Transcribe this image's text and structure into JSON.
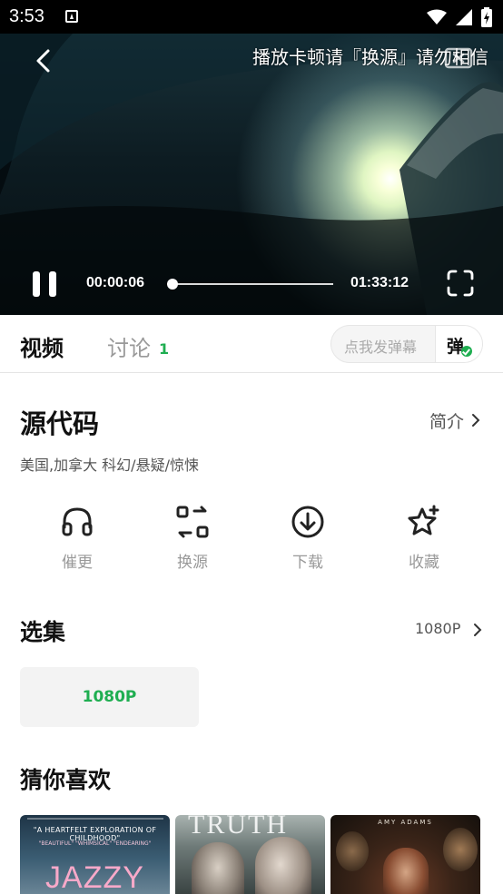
{
  "status_bar": {
    "time": "3:53"
  },
  "player": {
    "marquee": "播放卡顿请『换源』请勿相信",
    "current_time": "00:00:06",
    "total_time": "01:33:12",
    "progress_fraction": 0.001
  },
  "tabs": {
    "video": "视频",
    "discuss": "讨论",
    "discuss_count": "1"
  },
  "danmu": {
    "placeholder": "点我发弹幕",
    "button": "弹"
  },
  "movie": {
    "title": "源代码",
    "intro_link": "简介",
    "meta": "美国,加拿大  科幻/悬疑/惊悚"
  },
  "actions": [
    {
      "label": "催更",
      "icon": "headphones-icon"
    },
    {
      "label": "换源",
      "icon": "switch-source-icon"
    },
    {
      "label": "下载",
      "icon": "download-icon"
    },
    {
      "label": "收藏",
      "icon": "star-plus-icon"
    }
  ],
  "episodes": {
    "title": "选集",
    "quality": "1080P",
    "items": [
      "1080P"
    ]
  },
  "recommend": {
    "title": "猜你喜欢",
    "posters": [
      {
        "quote": "\"A HEARTFELT EXPLORATION OF CHILDHOOD\"",
        "tags": "\"BEAUTIFUL\"   \"WHIMSICAL\"   \"ENDEARING\"",
        "name": "JAZZY"
      },
      {
        "name": "TRUTH"
      },
      {
        "name": "AMY ADAMS"
      }
    ]
  },
  "colors": {
    "accent_green": "#1fae51",
    "text_primary": "#111111",
    "text_muted": "#999999"
  }
}
